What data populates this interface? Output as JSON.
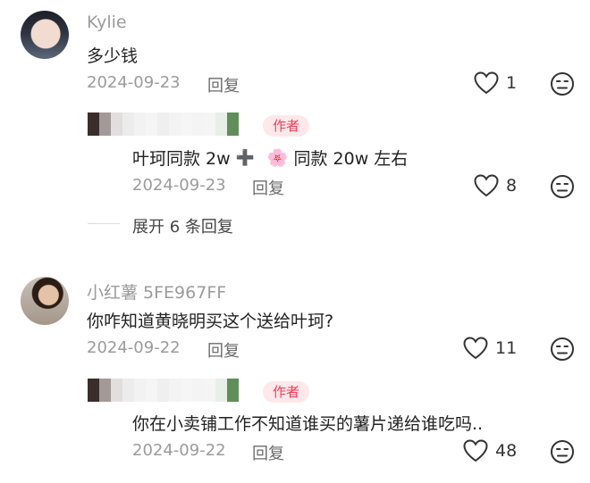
{
  "comments": [
    {
      "username": "Kylie",
      "text": "多少钱",
      "date": "2024-09-23",
      "reply_label": "回复",
      "likes": "1",
      "reply": {
        "badge": "作者",
        "text_a": "叶珂同款 2w",
        "plus": "➕",
        "flower": "🌸",
        "text_b": "同款 20w 左右",
        "date": "2024-09-23",
        "reply_label": "回复",
        "likes": "8"
      },
      "expand_label": "展开 6 条回复"
    },
    {
      "username": "小红薯 5FE967FF",
      "text": "你咋知道黄晓明买这个送给叶珂?",
      "date": "2024-09-22",
      "reply_label": "回复",
      "likes": "11",
      "reply": {
        "badge": "作者",
        "text": "你在小卖铺工作不知道谁买的薯片递给谁吃吗..",
        "date": "2024-09-22",
        "reply_label": "回复",
        "likes": "48"
      }
    }
  ],
  "icons": {
    "like": "heart-outline-icon",
    "emoji": "neutral-face-icon"
  },
  "colors": {
    "author_badge_bg": "#ffe8ea",
    "author_badge_text": "#ef3c55"
  }
}
